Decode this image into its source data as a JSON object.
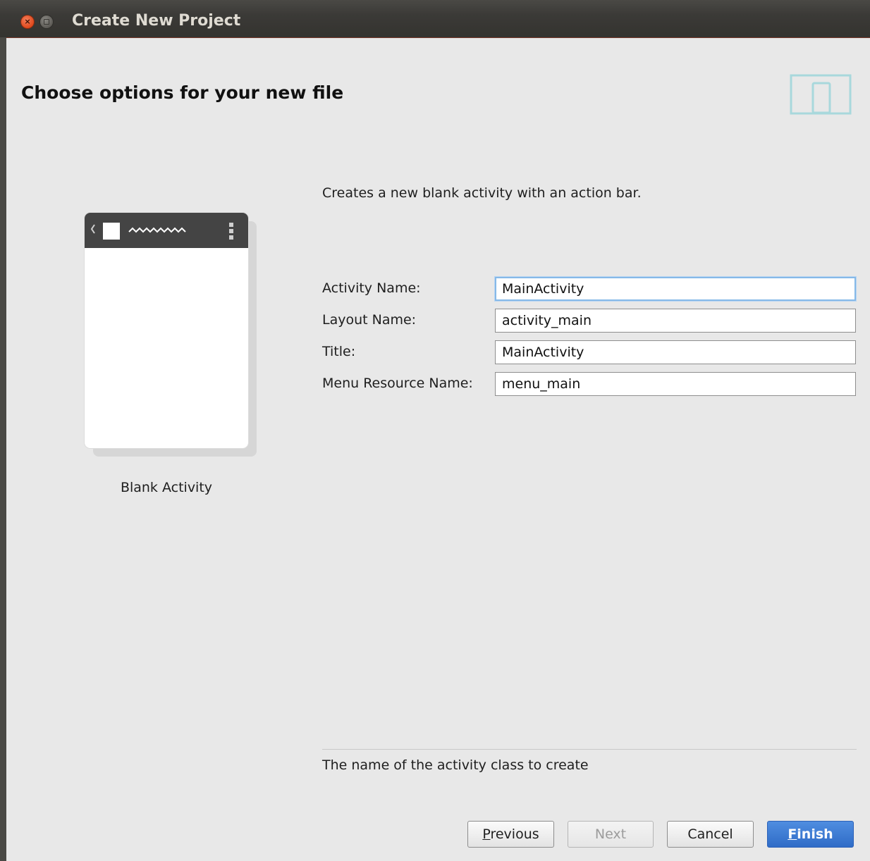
{
  "window": {
    "title": "Create New Project"
  },
  "page": {
    "title": "Choose options for your new file"
  },
  "template": {
    "label": "Blank Activity",
    "description": "Creates a new blank activity with an action bar."
  },
  "form": {
    "activity_name": {
      "label": "Activity Name:",
      "value": "MainActivity"
    },
    "layout_name": {
      "label": "Layout Name:",
      "value": "activity_main"
    },
    "title": {
      "label": "Title:",
      "value": "MainActivity"
    },
    "menu_resource_name": {
      "label": "Menu Resource Name:",
      "value": "menu_main"
    }
  },
  "help_text": "The name of the activity class to create",
  "buttons": {
    "previous": {
      "mnemonic": "P",
      "rest": "revious"
    },
    "next": "Next",
    "cancel": "Cancel",
    "finish": {
      "mnemonic": "F",
      "rest": "inish"
    }
  },
  "colors": {
    "primary_button": "#3a78d4",
    "device_icon": "#a8d8dc",
    "focus_ring": "#86b9e8",
    "close_button": "#e0491c"
  },
  "icons": [
    "close-icon",
    "maximize-icon",
    "device-icon",
    "chevron-left-icon",
    "overflow-menu-icon"
  ]
}
